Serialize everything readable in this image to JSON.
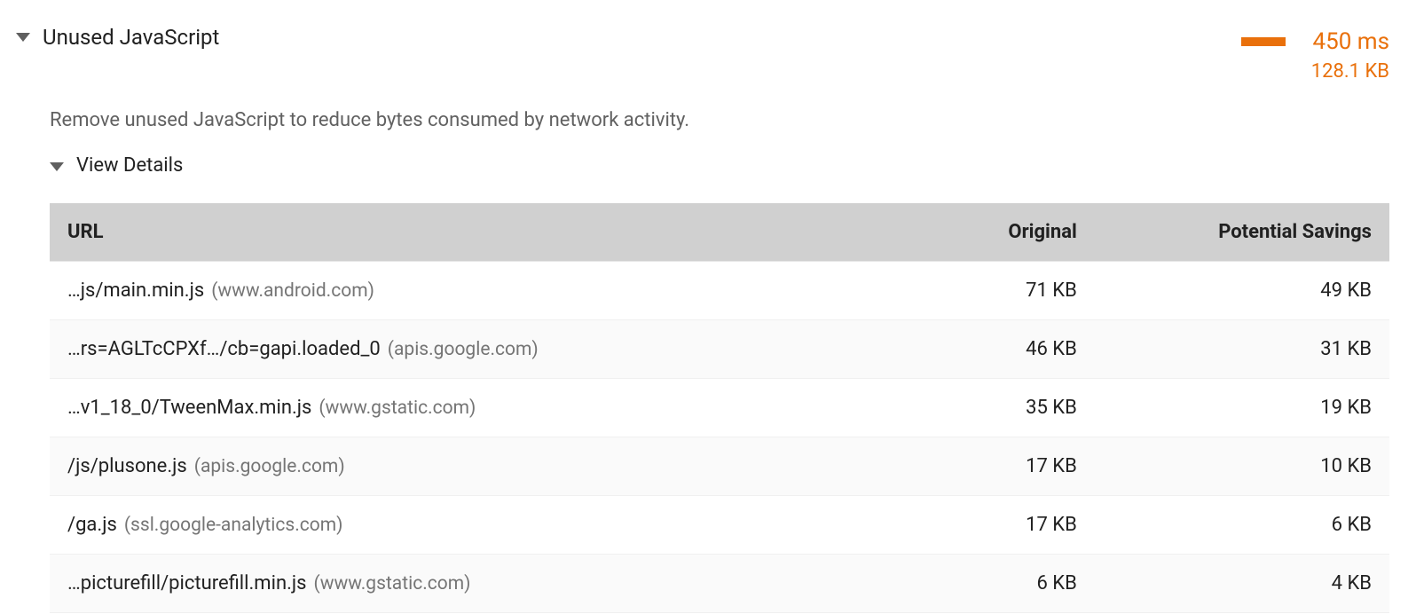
{
  "audit": {
    "title": "Unused JavaScript",
    "time_label": "450 ms",
    "size_label": "128.1 KB",
    "description": "Remove unused JavaScript to reduce bytes consumed by network activity.",
    "view_details_label": "View Details"
  },
  "table": {
    "headers": {
      "url": "URL",
      "original": "Original",
      "savings": "Potential Savings"
    },
    "rows": [
      {
        "path": "…js/main.min.js",
        "host": "(www.android.com)",
        "original": "71 KB",
        "savings": "49 KB"
      },
      {
        "path": "…rs=AGLTcCPXf…/cb=gapi.loaded_0",
        "host": "(apis.google.com)",
        "original": "46 KB",
        "savings": "31 KB"
      },
      {
        "path": "…v1_18_0/TweenMax.min.js",
        "host": "(www.gstatic.com)",
        "original": "35 KB",
        "savings": "19 KB"
      },
      {
        "path": "/js/plusone.js",
        "host": "(apis.google.com)",
        "original": "17 KB",
        "savings": "10 KB"
      },
      {
        "path": "/ga.js",
        "host": "(ssl.google-analytics.com)",
        "original": "17 KB",
        "savings": "6 KB"
      },
      {
        "path": "…picturefill/picturefill.min.js",
        "host": "(www.gstatic.com)",
        "original": "6 KB",
        "savings": "4 KB"
      }
    ]
  }
}
